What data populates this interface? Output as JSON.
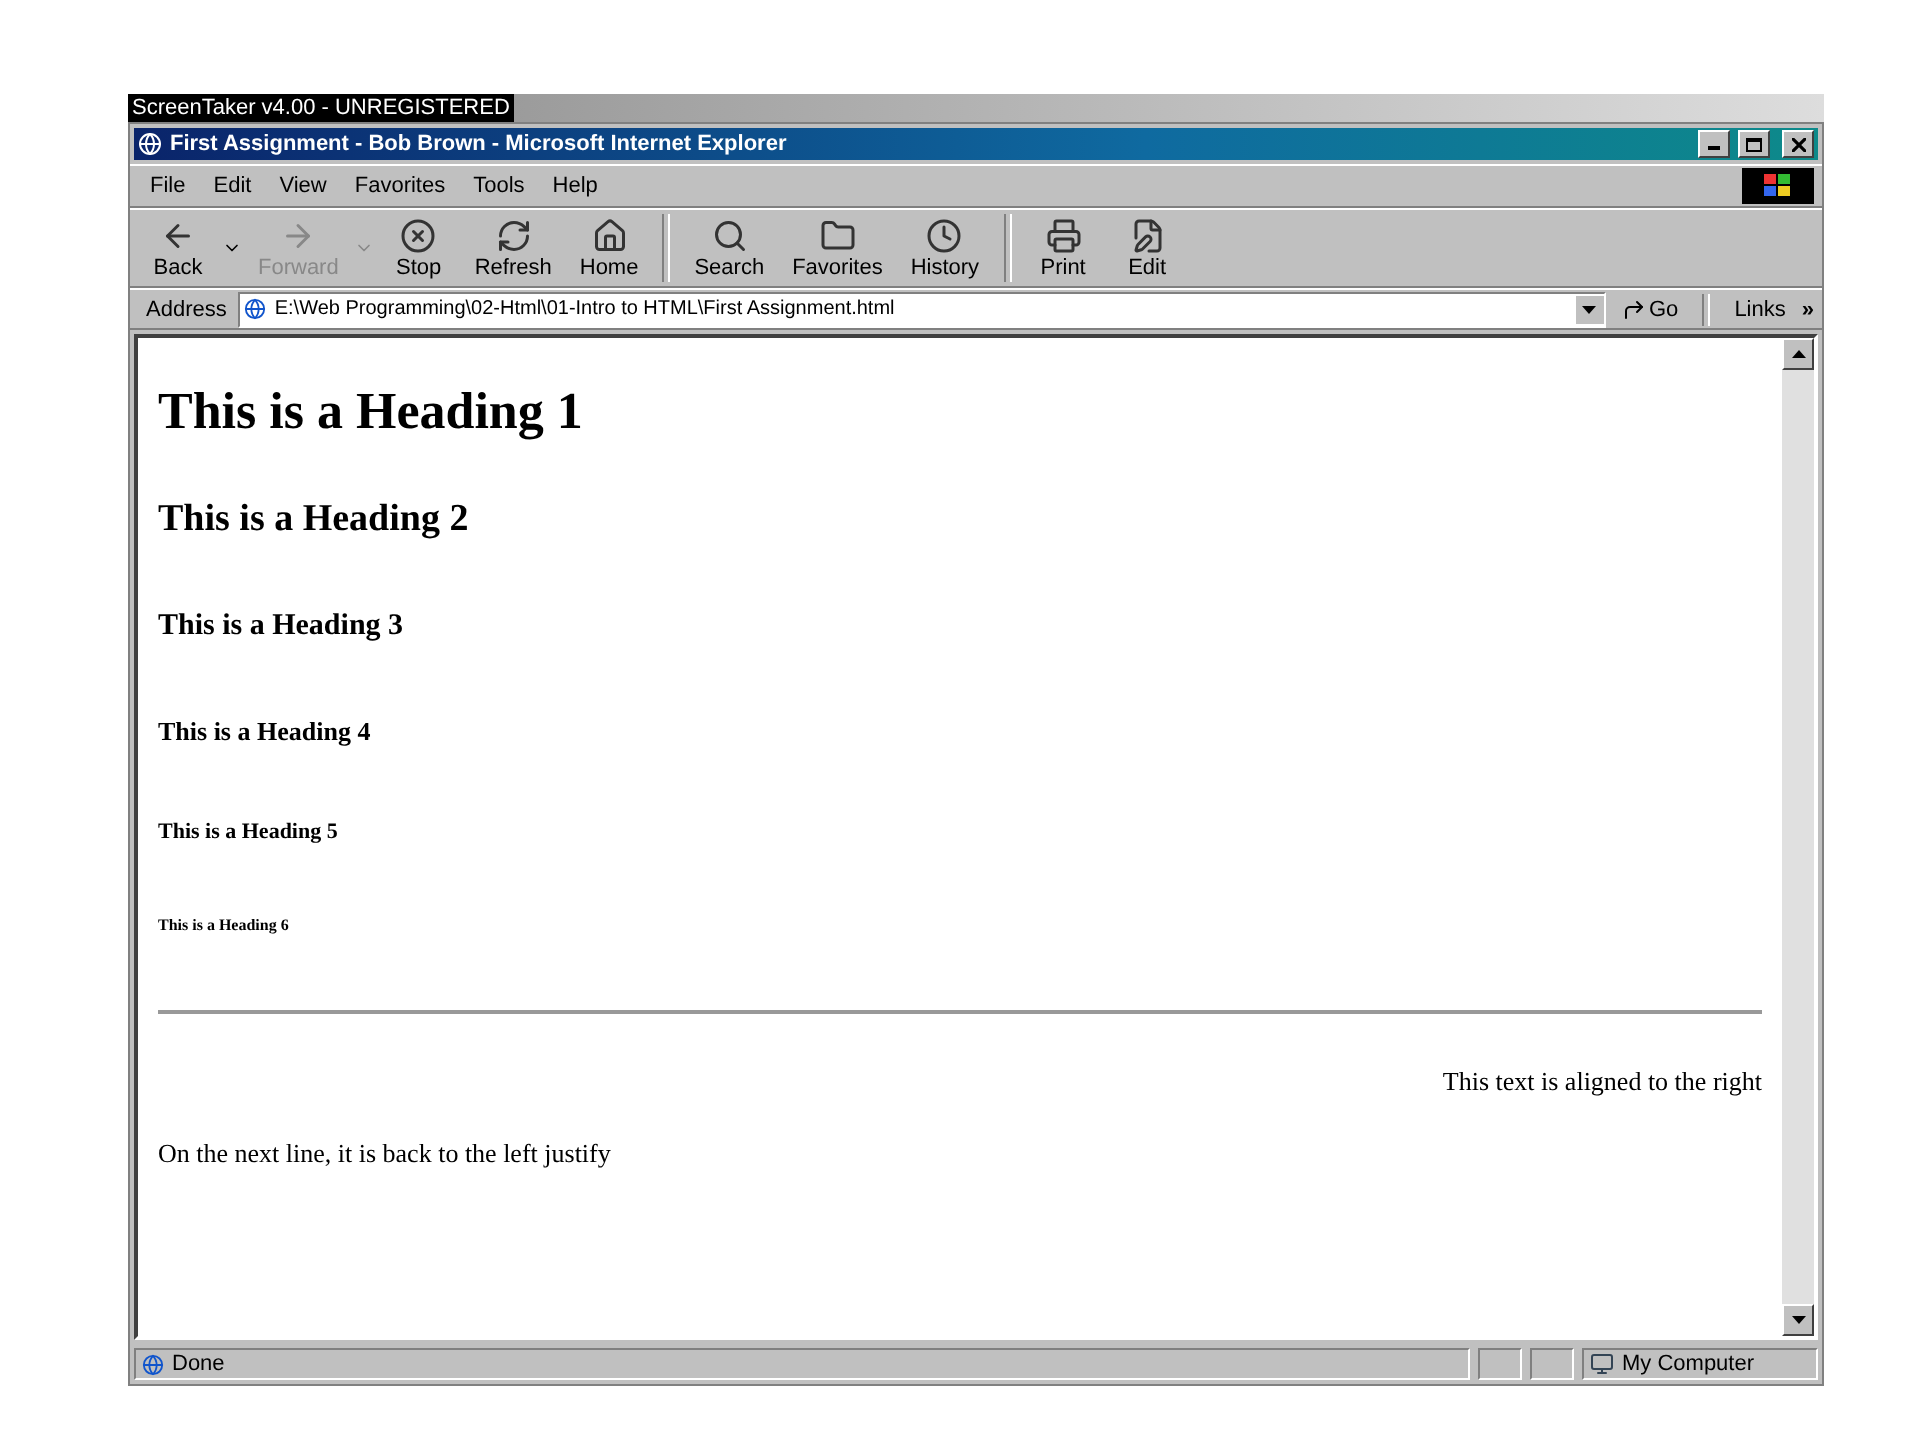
{
  "capture_banner": "ScreenTaker v4.00 - UNREGISTERED",
  "window": {
    "title": "First Assignment - Bob Brown - Microsoft Internet Explorer"
  },
  "menu": [
    "File",
    "Edit",
    "View",
    "Favorites",
    "Tools",
    "Help"
  ],
  "toolbar": [
    {
      "kind": "back",
      "label": "Back",
      "disabled": false,
      "dropdown": true
    },
    {
      "kind": "forward",
      "label": "Forward",
      "disabled": true,
      "dropdown": true
    },
    {
      "kind": "stop",
      "label": "Stop",
      "disabled": false,
      "dropdown": false
    },
    {
      "kind": "refresh",
      "label": "Refresh",
      "disabled": false,
      "dropdown": false
    },
    {
      "kind": "home",
      "label": "Home",
      "disabled": false,
      "dropdown": false
    },
    {
      "kind": "search",
      "label": "Search",
      "disabled": false,
      "dropdown": false
    },
    {
      "kind": "favorites",
      "label": "Favorites",
      "disabled": false,
      "dropdown": false
    },
    {
      "kind": "history",
      "label": "History",
      "disabled": false,
      "dropdown": false
    },
    {
      "kind": "print",
      "label": "Print",
      "disabled": false,
      "dropdown": false
    },
    {
      "kind": "edit",
      "label": "Edit",
      "disabled": false,
      "dropdown": false
    }
  ],
  "address_bar": {
    "label": "Address",
    "value": "E:\\Web Programming\\02-Html\\01-Intro to HTML\\First Assignment.html",
    "go": "Go",
    "links": "Links",
    "more": "»"
  },
  "content": [
    {
      "kind": "h1",
      "text": "This is a Heading 1"
    },
    {
      "kind": "h2",
      "text": "This is a Heading 2"
    },
    {
      "kind": "h3",
      "text": "This is a Heading 3"
    },
    {
      "kind": "h4",
      "text": "This is a Heading 4"
    },
    {
      "kind": "h5",
      "text": "This is a Heading 5"
    },
    {
      "kind": "h6",
      "text": "This is a Heading 6"
    },
    {
      "kind": "hr"
    },
    {
      "kind": "right",
      "text": "This text is aligned to the right"
    },
    {
      "kind": "left",
      "text": "On the next line, it is back to the left justify"
    }
  ],
  "status_bar": {
    "status": "Done",
    "zone": "My Computer"
  }
}
